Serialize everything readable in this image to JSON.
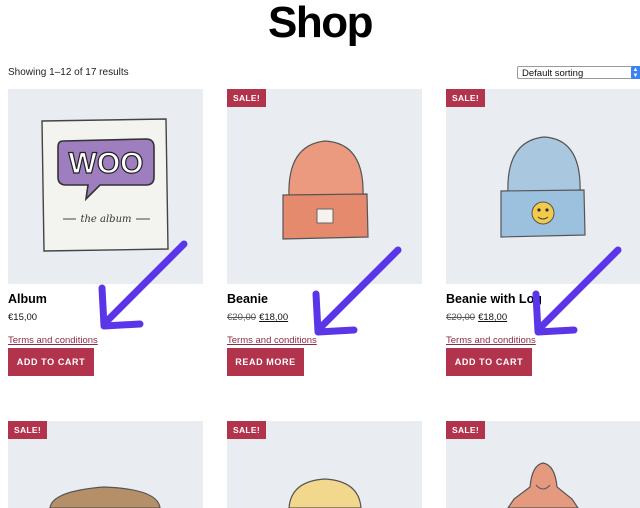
{
  "page": {
    "title": "Shop"
  },
  "toolbar": {
    "result_count": "Showing 1–12 of 17 results",
    "sorting": {
      "selected": "Default sorting"
    }
  },
  "products": [
    {
      "title": "Album",
      "price": "€15,00",
      "terms_link": "Terms and conditions",
      "button": "ADD TO CART",
      "image_icon": "woo-album-cover"
    },
    {
      "title": "Beanie",
      "badge": "SALE!",
      "old_price": "€20,00",
      "price": "€18,00",
      "terms_link": "Terms and conditions",
      "button": "READ MORE",
      "image_icon": "orange-beanie"
    },
    {
      "title": "Beanie with Log",
      "badge": "SALE!",
      "old_price": "€20,00",
      "price": "€18,00",
      "terms_link": "Terms and conditions",
      "button": "ADD TO CART",
      "image_icon": "blue-beanie-with-logo"
    }
  ],
  "second_row": [
    {
      "badge": "SALE!",
      "image_icon": "cap"
    },
    {
      "badge": "SALE!",
      "image_icon": "yellow-cap"
    },
    {
      "badge": "SALE!",
      "image_icon": "hoodie"
    }
  ],
  "album_art": {
    "word": "WOO",
    "subtitle": "the album"
  },
  "colors": {
    "accent": "#b1334c",
    "annotation_arrow": "#5b35e8",
    "image_bg": "#e9ecf1"
  }
}
